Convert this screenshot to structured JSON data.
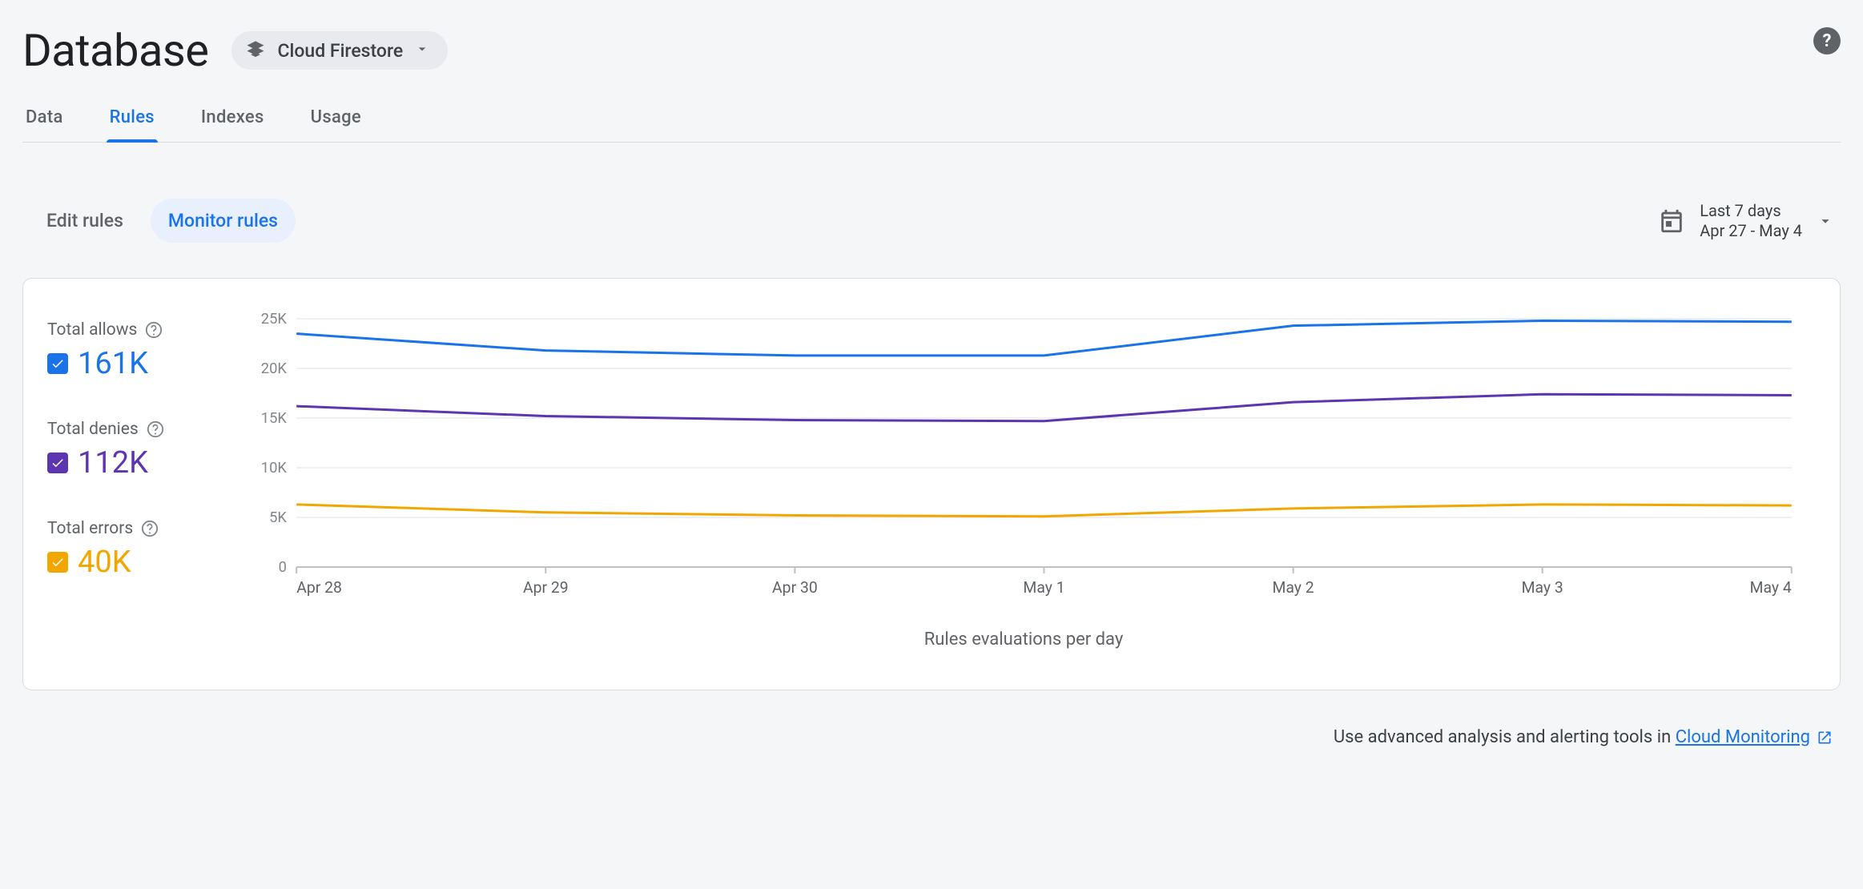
{
  "header": {
    "title": "Database",
    "selector_label": "Cloud Firestore"
  },
  "tabs": [
    {
      "label": "Data",
      "active": false
    },
    {
      "label": "Rules",
      "active": true
    },
    {
      "label": "Indexes",
      "active": false
    },
    {
      "label": "Usage",
      "active": false
    }
  ],
  "subtabs": [
    {
      "label": "Edit rules",
      "active": false
    },
    {
      "label": "Monitor rules",
      "active": true
    }
  ],
  "date_range": {
    "label": "Last 7 days",
    "value": "Apr 27 - May 4"
  },
  "legend": {
    "allows": {
      "label": "Total allows",
      "value": "161K",
      "color": "#1a73e8"
    },
    "denies": {
      "label": "Total denies",
      "value": "112K",
      "color": "#5e35b1"
    },
    "errors": {
      "label": "Total errors",
      "value": "40K",
      "color": "#f2a600"
    }
  },
  "chart_data": {
    "type": "line",
    "title": "",
    "xlabel": "Rules evaluations per day",
    "ylabel": "",
    "ylim": [
      0,
      25000
    ],
    "y_ticks": [
      0,
      5000,
      10000,
      15000,
      20000,
      25000
    ],
    "y_tick_labels": [
      "0",
      "5K",
      "10K",
      "15K",
      "20K",
      "25K"
    ],
    "categories": [
      "Apr 28",
      "Apr 29",
      "Apr 30",
      "May 1",
      "May 2",
      "May 3",
      "May 4"
    ],
    "series": [
      {
        "name": "Total allows",
        "color": "#1a73e8",
        "values": [
          23500,
          21800,
          21300,
          21300,
          24300,
          24800,
          24700
        ]
      },
      {
        "name": "Total denies",
        "color": "#5e35b1",
        "values": [
          16200,
          15200,
          14800,
          14700,
          16600,
          17400,
          17300
        ]
      },
      {
        "name": "Total errors",
        "color": "#f2a600",
        "values": [
          6300,
          5500,
          5200,
          5100,
          5900,
          6300,
          6200
        ]
      }
    ]
  },
  "footer": {
    "prefix": "Use advanced analysis and alerting tools in ",
    "link_label": "Cloud Monitoring"
  }
}
